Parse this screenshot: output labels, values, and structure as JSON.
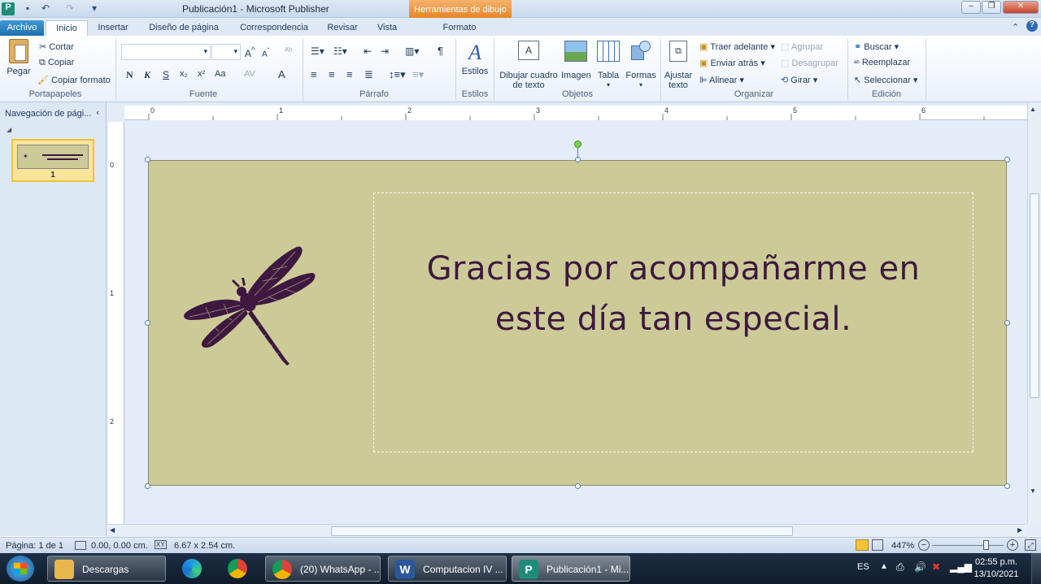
{
  "window": {
    "title": "Publicación1  -  Microsoft Publisher",
    "context_tab_group": "Herramientas de dibujo"
  },
  "tabs": [
    {
      "label": "Archivo"
    },
    {
      "label": "Inicio"
    },
    {
      "label": "Insertar"
    },
    {
      "label": "Diseño de página"
    },
    {
      "label": "Correspondencia"
    },
    {
      "label": "Revisar"
    },
    {
      "label": "Vista"
    },
    {
      "label": "Formato"
    }
  ],
  "ribbon": {
    "portapapeles": {
      "paste": "Pegar",
      "cut": "Cortar",
      "copy": "Copiar",
      "format_painter": "Copiar formato",
      "label": "Portapapeles"
    },
    "fuente": {
      "label": "Fuente",
      "bold": "N",
      "italic": "K",
      "underline": "S",
      "subscript": "x₂",
      "superscript": "x²",
      "case": "Aa",
      "spacing": "AV",
      "font_color": "A"
    },
    "parrafo": {
      "label": "Párrafo",
      "pilcrow": "¶"
    },
    "estilos": {
      "button": "Estilos",
      "label": "Estilos"
    },
    "objetos": {
      "textbox": "Dibujar cuadro de texto",
      "image": "Imagen",
      "table": "Tabla",
      "shapes": "Formas",
      "label": "Objetos"
    },
    "organizar": {
      "wrap": "Ajustar texto",
      "bring_forward": "Traer adelante",
      "send_backward": "Enviar atrás",
      "align": "Alinear",
      "group": "Agrupar",
      "ungroup": "Desagrupar",
      "rotate": "Girar",
      "label": "Organizar"
    },
    "edicion": {
      "find": "Buscar",
      "replace": "Reemplazar",
      "select": "Seleccionar",
      "label": "Edición"
    }
  },
  "navigation": {
    "title": "Navegación de pági...",
    "page_number": "1"
  },
  "ruler": {
    "h_ticks": [
      "0",
      "1",
      "2",
      "3",
      "4",
      "5",
      "6"
    ],
    "v_ticks": [
      "0",
      "1",
      "2"
    ]
  },
  "document": {
    "greeting_line1": "Gracias por acompañarme en",
    "greeting_line2": "este día tan especial.",
    "background_color": "#cccb98",
    "text_color": "#3e1840",
    "image_icon": "dragonfly-icon"
  },
  "status": {
    "page": "Página: 1 de 1",
    "position": "0.00, 0.00 cm.",
    "size": "6.67 x  2.54 cm.",
    "zoom": "447%"
  },
  "taskbar": {
    "items": [
      {
        "label": "Descargas"
      },
      {
        "label": "(20) WhatsApp - ..."
      },
      {
        "label": "Computacion IV ..."
      },
      {
        "label": "Publicación1 - Mi..."
      }
    ],
    "language": "ES",
    "time": "02:55 p.m.",
    "date": "13/10/2021"
  }
}
